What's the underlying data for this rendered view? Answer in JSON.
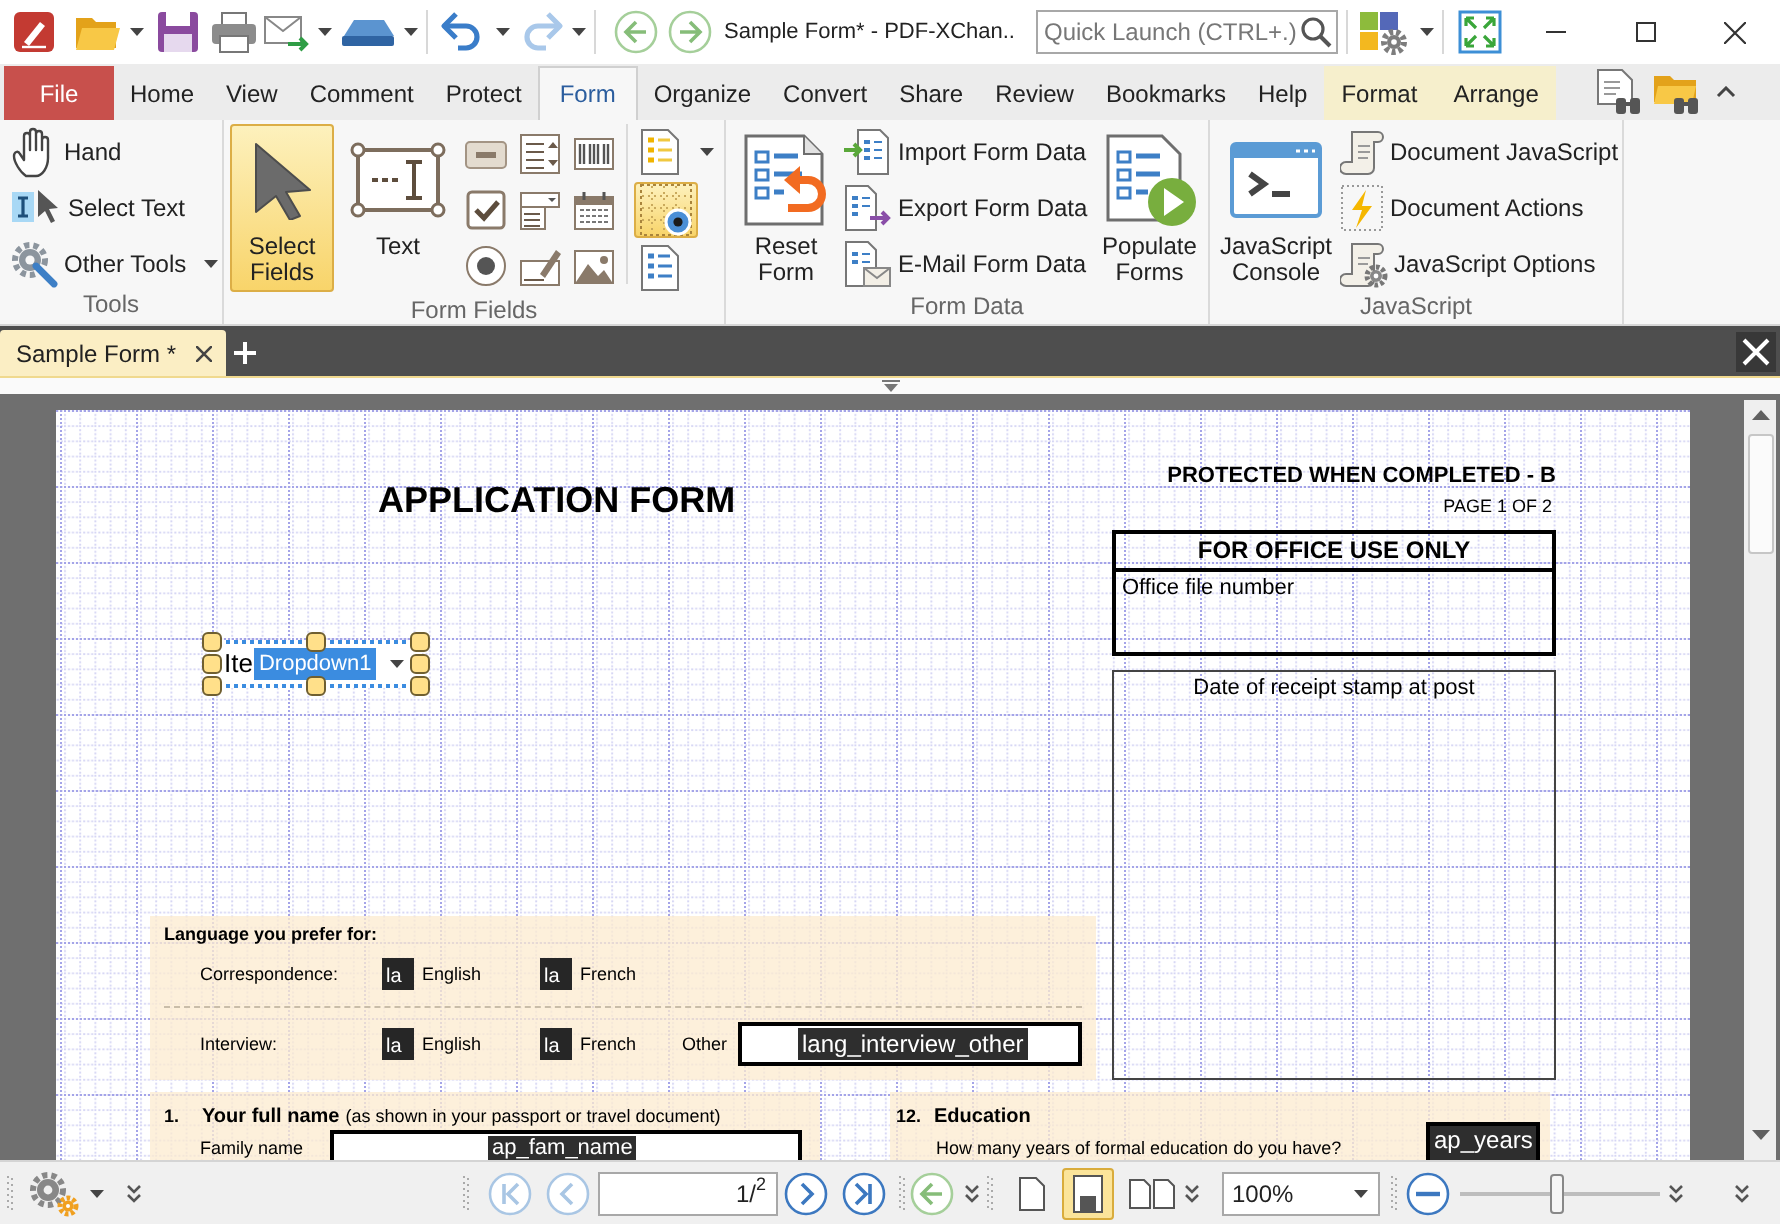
{
  "title_bar": {
    "quick_access": [
      {
        "kind": "open",
        "menu": true
      },
      {
        "kind": "save"
      },
      {
        "kind": "print"
      },
      {
        "kind": "email",
        "menu": true
      },
      {
        "kind": "scan",
        "menu": true
      },
      {
        "kind": "undo",
        "menu": true,
        "disabled": false
      },
      {
        "kind": "redo",
        "menu": true,
        "disabled": true
      }
    ],
    "title": "Sample Form* - PDF-XChan..",
    "quick_launch": {
      "placeholder": "Quick Launch (CTRL+.)"
    }
  },
  "menu_tabs": [
    {
      "label": "File",
      "kind": "file",
      "selected": false
    },
    {
      "label": "Home",
      "kind": "tab",
      "selected": false
    },
    {
      "label": "View",
      "kind": "tab",
      "selected": false
    },
    {
      "label": "Comment",
      "kind": "tab",
      "selected": false
    },
    {
      "label": "Protect",
      "kind": "tab",
      "selected": false
    },
    {
      "label": "Form",
      "kind": "tab",
      "selected": true
    },
    {
      "label": "Organize",
      "kind": "tab",
      "selected": false
    },
    {
      "label": "Convert",
      "kind": "tab",
      "selected": false
    },
    {
      "label": "Share",
      "kind": "tab",
      "selected": false
    },
    {
      "label": "Review",
      "kind": "tab",
      "selected": false
    },
    {
      "label": "Bookmarks",
      "kind": "tab",
      "selected": false
    },
    {
      "label": "Help",
      "kind": "tab",
      "selected": false
    },
    {
      "label": "Format",
      "kind": "contextual",
      "selected": false
    },
    {
      "label": "Arrange",
      "kind": "contextual",
      "selected": false
    }
  ],
  "ribbon": {
    "tools": {
      "label": "Tools",
      "items": [
        {
          "label": "Hand",
          "kind": "hand",
          "selected": false
        },
        {
          "label": "Select Text",
          "kind": "select_text",
          "selected": false
        },
        {
          "label": "Other Tools",
          "kind": "other_tools",
          "selected": false,
          "menu": true
        }
      ]
    },
    "form_fields": {
      "label": "Form Fields",
      "tools": [
        {
          "label": "Select Fields",
          "kind": "pointer",
          "selected": true
        },
        {
          "label": "Text",
          "kind": "text_field",
          "selected": false
        }
      ],
      "field_types": [
        {
          "kind": "button",
          "selected": false
        },
        {
          "kind": "checkbox",
          "selected": false
        },
        {
          "kind": "radio",
          "selected": false
        },
        {
          "kind": "listbox",
          "selected": false
        },
        {
          "kind": "combobox",
          "selected": false
        },
        {
          "kind": "signature",
          "selected": false
        },
        {
          "kind": "barcode",
          "selected": false
        },
        {
          "kind": "date",
          "selected": false
        },
        {
          "kind": "image",
          "selected": false
        }
      ],
      "options": [
        {
          "kind": "fields_doc",
          "menu": true,
          "selected": false
        },
        {
          "kind": "grid",
          "selected": true
        },
        {
          "kind": "form_doc",
          "selected": false
        }
      ]
    },
    "form_data": {
      "label": "Form Data",
      "items": [
        {
          "label": "Reset Form",
          "kind": "reset"
        },
        {
          "label": "Import Form Data",
          "kind": "import"
        },
        {
          "label": "Export Form Data",
          "kind": "export"
        },
        {
          "label": "E-Mail Form Data",
          "kind": "email"
        },
        {
          "label": "Populate Forms",
          "kind": "populate"
        }
      ]
    },
    "javascript": {
      "label": "JavaScript",
      "items": [
        {
          "label": "JavaScript Console",
          "kind": "console"
        },
        {
          "label": "Document JavaScript",
          "kind": "script"
        },
        {
          "label": "Document Actions",
          "kind": "actions"
        },
        {
          "label": "JavaScript Options",
          "kind": "options"
        }
      ]
    }
  },
  "document_tabs": [
    {
      "label": "Sample Form *",
      "selected": true
    }
  ],
  "page": {
    "title": "APPLICATION FORM",
    "protection_note": "PROTECTED WHEN COMPLETED - B",
    "page_label": "PAGE 1 OF 2",
    "office_box": {
      "heading": "FOR OFFICE USE ONLY",
      "field_label": "Office file number"
    },
    "stamp_box": {
      "label": "Date of receipt stamp at post"
    },
    "selected_field": {
      "value": "Ite",
      "name": "Dropdown1"
    },
    "language": {
      "heading": "Language you prefer for:",
      "rows": [
        {
          "label": "Correspondence:",
          "options": [
            {
              "field_name": "la",
              "label": "English"
            },
            {
              "field_name": "la",
              "label": "French"
            }
          ]
        },
        {
          "label": "Interview:",
          "options": [
            {
              "field_name": "la",
              "label": "English"
            },
            {
              "field_name": "la",
              "label": "French"
            }
          ],
          "other": {
            "label": "Other",
            "field_name": "lang_interview_other"
          }
        }
      ]
    },
    "sections": [
      {
        "kind": "labeled_field",
        "number": "1.",
        "title": "Your full name",
        "note": "(as shown in your passport or travel document)",
        "field_label": "Family name",
        "field_name": "ap_fam_name"
      },
      {
        "kind": "question",
        "number": "12.",
        "title": "Education",
        "question": "How many years of formal education do you have?",
        "field_name": "ap_years"
      }
    ]
  },
  "status_bar": {
    "navigation": [
      {
        "kind": "first",
        "disabled": true
      },
      {
        "kind": "previous",
        "disabled": true
      },
      {
        "kind": "next",
        "disabled": false
      },
      {
        "kind": "last",
        "disabled": false
      }
    ],
    "page_field": {
      "value": "1/$^{2}$"
    },
    "view_modes": [
      {
        "kind": "single",
        "selected": false
      },
      {
        "kind": "continuous",
        "selected": true
      },
      {
        "kind": "facing",
        "selected": false
      }
    ],
    "zoom": {
      "value": "100%"
    },
    "zoom_slider": {
      "level": 0.48
    }
  }
}
